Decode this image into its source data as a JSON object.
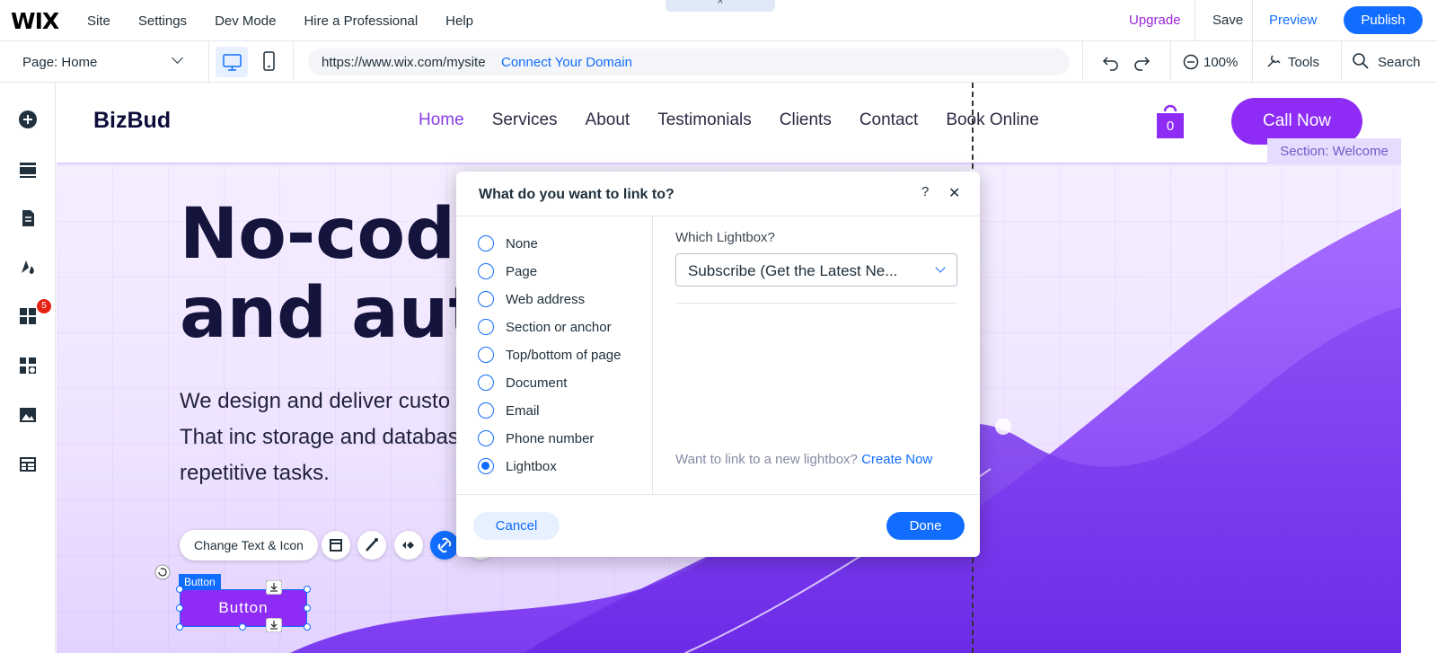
{
  "topbar": {
    "logo": "WIX",
    "menu": [
      "Site",
      "Settings",
      "Dev Mode",
      "Hire a Professional",
      "Help"
    ],
    "upgrade": "Upgrade",
    "save": "Save",
    "preview": "Preview",
    "publish": "Publish",
    "collapse_icon": "^"
  },
  "toolbar2": {
    "page": "Page: Home",
    "url": "https://www.wix.com/mysite",
    "connect": "Connect Your Domain",
    "zoom": "100%",
    "tools": "Tools",
    "search": "Search"
  },
  "rail": {
    "badge": "5"
  },
  "site": {
    "brand": "BizBud",
    "nav": [
      "Home",
      "Services",
      "About",
      "Testimonials",
      "Clients",
      "Contact",
      "Book Online"
    ],
    "cart_count": "0",
    "call_now": "Call Now",
    "section_label": "Section: Welcome",
    "hero_line1": "No-code",
    "hero_line2": "and auto",
    "hero_body": "We design and deliver custo apps to our clients. That inc storage and database creati to eliminate repetitive tasks."
  },
  "floating": {
    "change_text": "Change Text & Icon",
    "selection_label": "Button",
    "button_text": "Button"
  },
  "dialog": {
    "title": "What do you want to link to?",
    "help": "?",
    "close": "✕",
    "options": [
      "None",
      "Page",
      "Web address",
      "Section or anchor",
      "Top/bottom of page",
      "Document",
      "Email",
      "Phone number",
      "Lightbox"
    ],
    "selected": "Lightbox",
    "which_label": "Which Lightbox?",
    "lightbox_value": "Subscribe (Get the Latest Ne...",
    "want_text": "Want to link to a new lightbox?",
    "create_now": "Create Now",
    "cancel": "Cancel",
    "done": "Done"
  },
  "colors": {
    "accent": "#116dff",
    "purple": "#8e2cf5",
    "upgrade": "#9a27d5"
  }
}
